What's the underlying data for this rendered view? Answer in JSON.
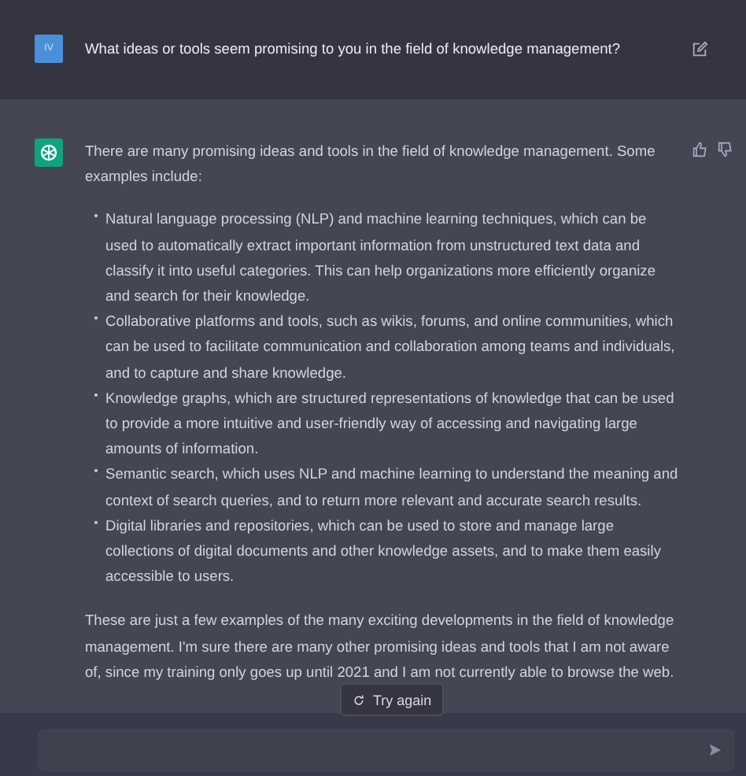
{
  "user_message": {
    "avatar": "IV",
    "text": "What ideas or tools seem promising to you in the field of knowledge management?"
  },
  "assistant_message": {
    "intro": "There are many promising ideas and tools in the field of knowledge management. Some examples include:",
    "bullets": [
      "Natural language processing (NLP) and machine learning techniques, which can be used to automatically extract important information from unstructured text data and classify it into useful categories. This can help organizations more efficiently organize and search for their knowledge.",
      "Collaborative platforms and tools, such as wikis, forums, and online communities, which can be used to facilitate communication and collaboration among teams and individuals, and to capture and share knowledge.",
      "Knowledge graphs, which are structured representations of knowledge that can be used to provide a more intuitive and user-friendly way of accessing and navigating large amounts of information.",
      "Semantic search, which uses NLP and machine learning to understand the meaning and context of search queries, and to return more relevant and accurate search results.",
      "Digital libraries and repositories, which can be used to store and manage large collections of digital documents and other knowledge assets, and to make them easily accessible to users."
    ],
    "outro": "These are just a few examples of the many exciting developments in the field of knowledge management. I'm sure there are many other promising ideas and tools that I am not aware of, since my training only goes up until 2021 and I am not currently able to browse the web."
  },
  "try_again_button": "Try again"
}
